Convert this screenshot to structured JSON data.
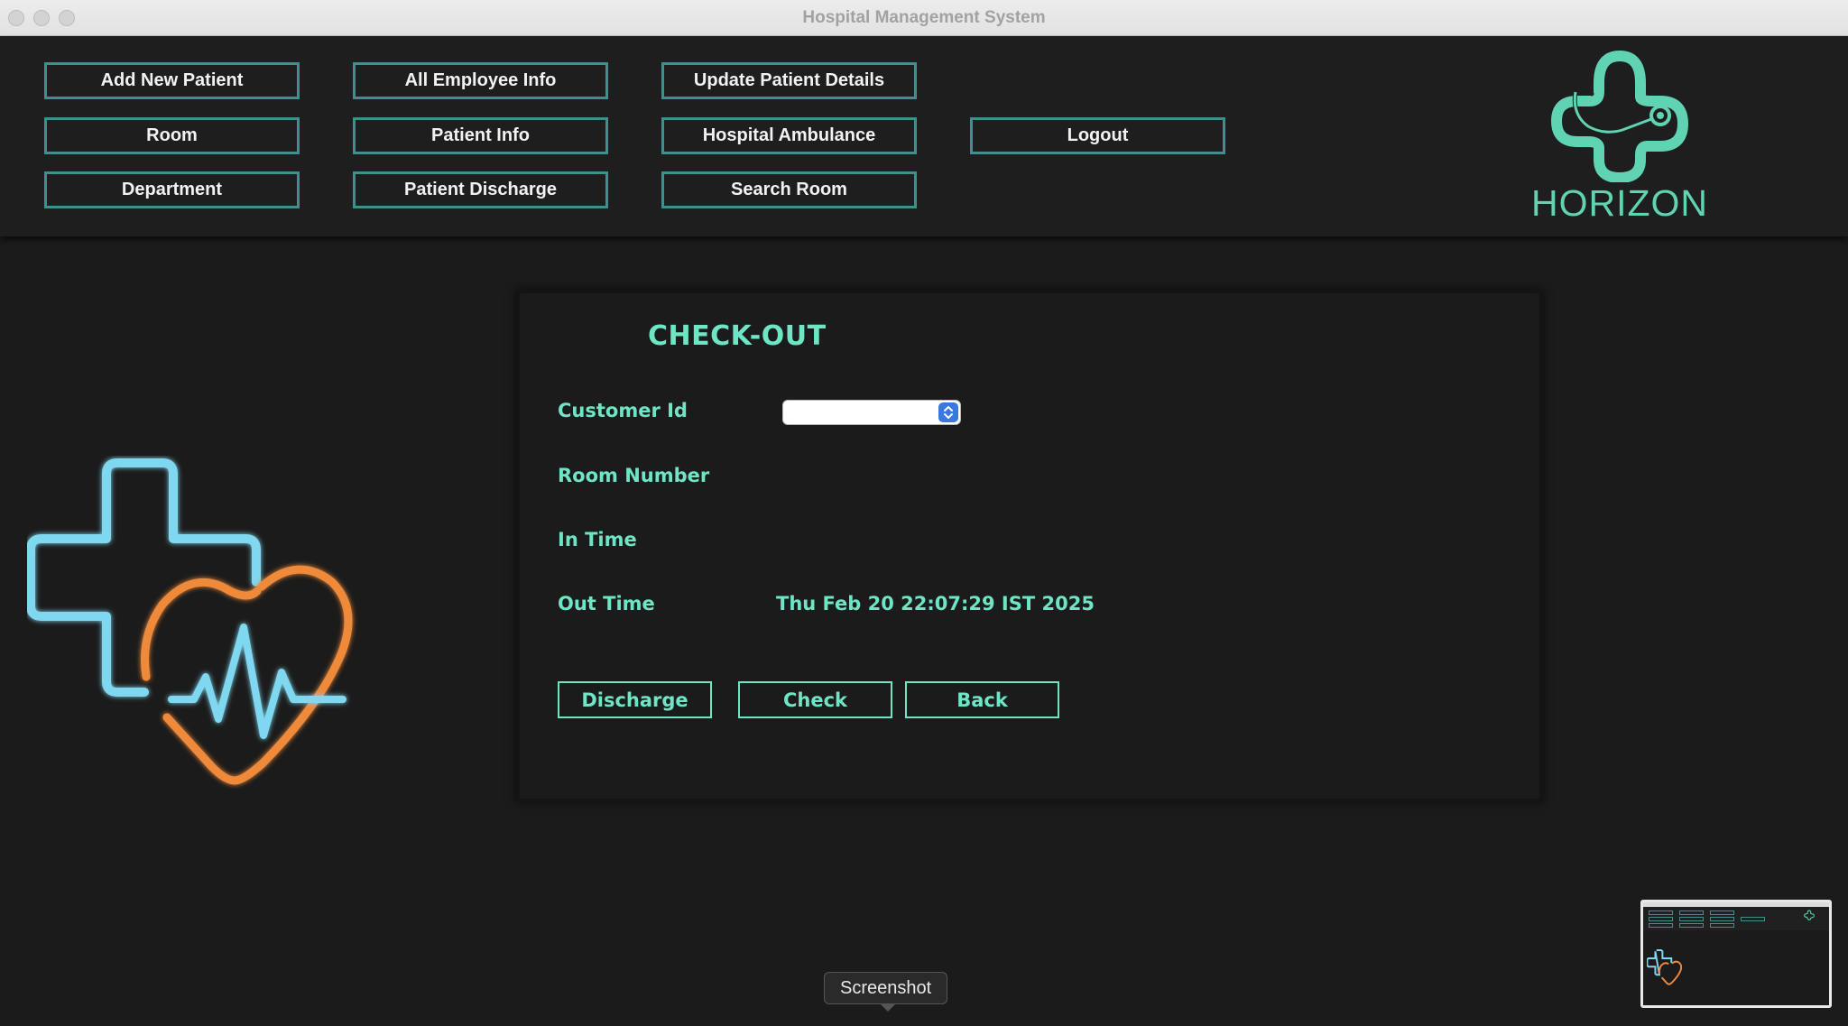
{
  "window": {
    "title": "Hospital Management System"
  },
  "nav": {
    "buttons": [
      "Add New Patient",
      "All Employee Info",
      "Update Patient Details",
      "Room",
      "Patient Info",
      "Hospital Ambulance",
      "Logout",
      "Department",
      "Patient Discharge",
      "Search Room"
    ]
  },
  "logo": {
    "brand": "HORIZON",
    "icon": "stethoscope-cross-icon",
    "color": "#5fd3b2"
  },
  "illustration": {
    "icon": "medical-cross-heartbeat-icon",
    "cross_color": "#7fd8f0",
    "heart_color": "#f08a3a"
  },
  "checkout": {
    "heading": "CHECK-OUT",
    "labels": {
      "customer_id": "Customer Id",
      "room_number": "Room Number",
      "in_time": "In Time",
      "out_time": "Out Time"
    },
    "values": {
      "customer_id": "",
      "room_number": "",
      "in_time": "",
      "out_time": "Thu Feb 20 22:07:29 IST 2025"
    },
    "buttons": {
      "discharge": "Discharge",
      "check": "Check",
      "back": "Back"
    },
    "accent_color": "#6ee6c6"
  },
  "tooltip": {
    "text": "Screenshot"
  }
}
